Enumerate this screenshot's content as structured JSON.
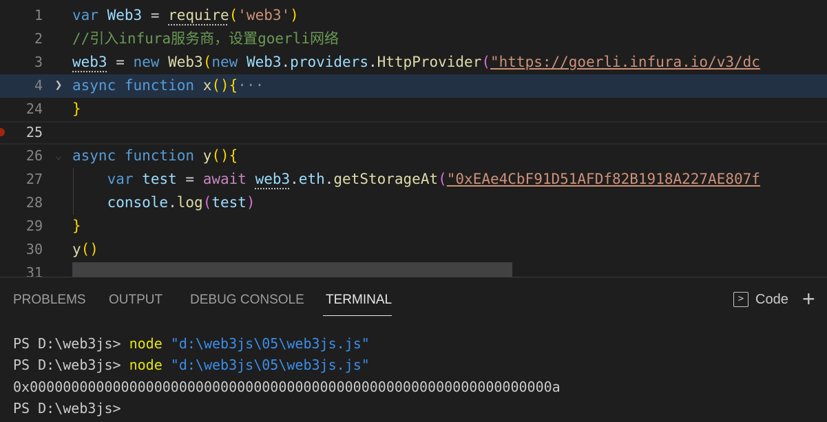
{
  "editor": {
    "lines": [
      {
        "num": "1",
        "parts": [
          {
            "t": "var",
            "c": "kw"
          },
          {
            "t": " ",
            "c": "pl"
          },
          {
            "t": "Web3",
            "c": "id"
          },
          {
            "t": " = ",
            "c": "pl"
          },
          {
            "t": "require",
            "c": "fn"
          },
          {
            "t": "(",
            "c": "br1"
          },
          {
            "t": "'web3'",
            "c": "str"
          },
          {
            "t": ")",
            "c": "br1"
          }
        ]
      },
      {
        "num": "2",
        "parts": [
          {
            "t": "//引入infura服务商，设置goerli网络",
            "c": "cm"
          }
        ]
      },
      {
        "num": "3",
        "parts": [
          {
            "t": "web3",
            "c": "id"
          },
          {
            "t": " = ",
            "c": "pl"
          },
          {
            "t": "new",
            "c": "kw"
          },
          {
            "t": " ",
            "c": "pl"
          },
          {
            "t": "Web3",
            "c": "fn"
          },
          {
            "t": "(",
            "c": "br1"
          },
          {
            "t": "new",
            "c": "kw"
          },
          {
            "t": " ",
            "c": "pl"
          },
          {
            "t": "Web3",
            "c": "id"
          },
          {
            "t": ".",
            "c": "pl"
          },
          {
            "t": "providers",
            "c": "id"
          },
          {
            "t": ".",
            "c": "pl"
          },
          {
            "t": "HttpProvider",
            "c": "fn"
          },
          {
            "t": "(",
            "c": "br2"
          },
          {
            "t": "\"https://goerli.infura.io/v3/dc",
            "c": "str"
          }
        ]
      },
      {
        "num": "4",
        "parts": [
          {
            "t": "async",
            "c": "kw"
          },
          {
            "t": " ",
            "c": "pl"
          },
          {
            "t": "function",
            "c": "kw"
          },
          {
            "t": " ",
            "c": "pl"
          },
          {
            "t": "x",
            "c": "fn"
          },
          {
            "t": "(){",
            "c": "br1"
          },
          {
            "t": "···",
            "c": "ellip"
          }
        ]
      },
      {
        "num": "24",
        "parts": [
          {
            "t": "}",
            "c": "br1"
          }
        ]
      },
      {
        "num": "25",
        "parts": []
      },
      {
        "num": "26",
        "parts": [
          {
            "t": "async",
            "c": "kw"
          },
          {
            "t": " ",
            "c": "pl"
          },
          {
            "t": "function",
            "c": "kw"
          },
          {
            "t": " ",
            "c": "pl"
          },
          {
            "t": "y",
            "c": "fn"
          },
          {
            "t": "(){",
            "c": "br1"
          }
        ]
      },
      {
        "num": "27",
        "parts": [
          {
            "t": "    ",
            "c": "pl"
          },
          {
            "t": "var",
            "c": "kw"
          },
          {
            "t": " ",
            "c": "pl"
          },
          {
            "t": "test",
            "c": "id"
          },
          {
            "t": " = ",
            "c": "pl"
          },
          {
            "t": "await",
            "c": "ctl"
          },
          {
            "t": " ",
            "c": "pl"
          },
          {
            "t": "web3",
            "c": "id"
          },
          {
            "t": ".",
            "c": "pl"
          },
          {
            "t": "eth",
            "c": "id"
          },
          {
            "t": ".",
            "c": "pl"
          },
          {
            "t": "getStorageAt",
            "c": "fn"
          },
          {
            "t": "(",
            "c": "br2"
          },
          {
            "t": "\"0xEAe4CbF91D51AFDf82B1918A227AE807f",
            "c": "str"
          }
        ]
      },
      {
        "num": "28",
        "parts": [
          {
            "t": "    ",
            "c": "pl"
          },
          {
            "t": "console",
            "c": "id"
          },
          {
            "t": ".",
            "c": "pl"
          },
          {
            "t": "log",
            "c": "fn"
          },
          {
            "t": "(",
            "c": "br2"
          },
          {
            "t": "test",
            "c": "id"
          },
          {
            "t": ")",
            "c": "br2"
          }
        ]
      },
      {
        "num": "29",
        "parts": [
          {
            "t": "}",
            "c": "br1"
          }
        ]
      },
      {
        "num": "30",
        "parts": [
          {
            "t": "y",
            "c": "fn"
          },
          {
            "t": "()",
            "c": "br1"
          }
        ]
      },
      {
        "num": "31",
        "parts": []
      }
    ]
  },
  "panel": {
    "tabs": [
      "PROBLEMS",
      "OUTPUT",
      "DEBUG CONSOLE",
      "TERMINAL"
    ],
    "active_tab": "TERMINAL",
    "terminal_label": "Code",
    "plus": "+"
  },
  "terminal": {
    "prompt": "PS D:\\web3js> ",
    "cmd": "node",
    "arg": "\"d:\\web3js\\05\\web3js.js\"",
    "output": "0x000000000000000000000000000000000000000000000000000000000000000a",
    "last_prompt": "PS D:\\web3js>"
  }
}
